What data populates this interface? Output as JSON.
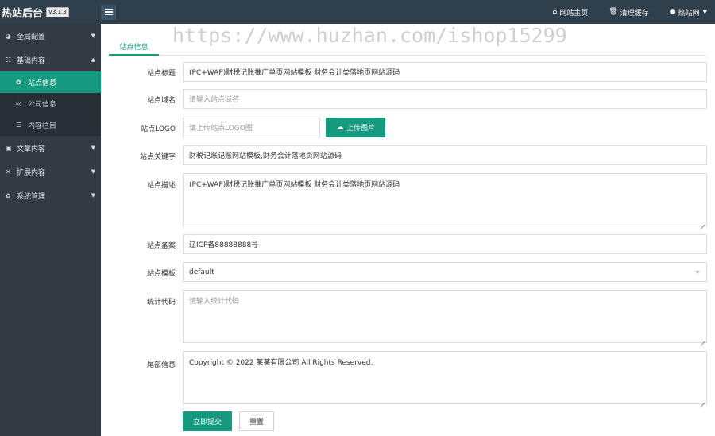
{
  "brand": {
    "title": "热站后台",
    "version": "V3.1.3"
  },
  "topnav": [
    {
      "icon": "home-icon",
      "glyph": "⌂",
      "label": "网站主页"
    },
    {
      "icon": "trash-icon",
      "glyph": "🗑",
      "label": "清理缓存"
    },
    {
      "icon": "user-icon",
      "glyph": "●",
      "label": "热站网"
    }
  ],
  "sidebar": {
    "global": {
      "glyph": "◕",
      "label": "全局配置"
    },
    "basic": {
      "glyph": "☷",
      "label": "基础内容"
    },
    "basic_items": [
      {
        "glyph": "✿",
        "label": "站点信息"
      },
      {
        "glyph": "◎",
        "label": "公司信息"
      },
      {
        "glyph": "☰",
        "label": "内容栏目"
      }
    ],
    "article": {
      "glyph": "▣",
      "label": "文章内容"
    },
    "extend": {
      "glyph": "✕",
      "label": "扩展内容"
    },
    "system": {
      "glyph": "✿",
      "label": "系统管理"
    }
  },
  "tab": {
    "label": "站点信息"
  },
  "watermark": "https://www.huzhan.com/ishop15299",
  "form": {
    "title": {
      "label": "站点标题",
      "value": "(PC+WAP)财税记账推广单页网站模板 财务会计类落地页网站源码"
    },
    "domain": {
      "label": "站点域名",
      "placeholder": "请输入站点域名"
    },
    "logo": {
      "label": "站点LOGO",
      "placeholder": "请上传站点LOGO图",
      "upload_label": "上传图片"
    },
    "keywords": {
      "label": "站点关键字",
      "value": "财税记账记账网站模板,财务会计落地页网站源码"
    },
    "description": {
      "label": "站点描述",
      "value": "(PC+WAP)财税记账推广单页网站模板 财务会计类落地页网站源码"
    },
    "icp": {
      "label": "站点备案",
      "value": "辽ICP备88888888号"
    },
    "template": {
      "label": "站点模板",
      "value": "default"
    },
    "stats": {
      "label": "统计代码",
      "placeholder": "请输入统计代码"
    },
    "footer": {
      "label": "尾部信息",
      "value": "Copyright © 2022 某某有限公司 All Rights Reserved."
    },
    "submit_label": "立即提交",
    "reset_label": "重置"
  },
  "colors": {
    "accent": "#159a80",
    "topbar": "#2f3f4c",
    "sidebar": "#323b44"
  }
}
